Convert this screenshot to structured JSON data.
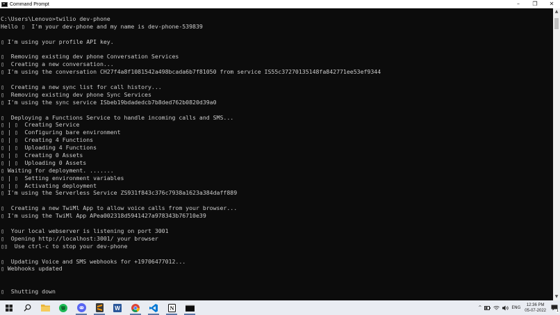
{
  "window": {
    "title": "Command Prompt",
    "controls": {
      "minimize": "–",
      "maximize": "❐",
      "close": "✕"
    }
  },
  "console": {
    "lines": [
      "C:\\Users\\Lenovo>twilio dev-phone",
      "Hello ▯  I'm your dev-phone and my name is dev-phone-539839",
      "",
      "▯ I'm using your profile API key.",
      "",
      "▯  Removing existing dev phone Conversation Services",
      "▯  Creating a new conversation...",
      "▯ I'm using the conversation CH27f4a8f1081542a498bcada6b7f81050 from service IS55c37270135148fa842771ee53ef9344",
      "",
      "▯  Creating a new sync list for call history...",
      "▯  Removing existing dev phone Sync Services",
      "▯ I'm using the sync service ISbeb19bdadedcb7b8ded762b0820d39a0",
      "",
      "▯  Deploying a Functions Service to handle incoming calls and SMS...",
      "▯ | ▯  Creating Service",
      "▯ | ▯  Configuring bare environment",
      "▯ | ▯  Creating 4 Functions",
      "▯ | ▯  Uploading 4 Functions",
      "▯ | ▯  Creating 0 Assets",
      "▯ | ▯  Uploading 0 Assets",
      "▯ Waiting for deployment. .......",
      "▯ | ▯  Setting environment variables",
      "▯ | ▯  Activating deployment",
      "▯ I'm using the Serverless Service ZS931f843c376c7938a1623a384daff889",
      "",
      "▯  Creating a new TwiMl App to allow voice calls from your browser...",
      "▯ I'm using the TwiMl App APea002318d5941427a978343b76710e39",
      "",
      "▯  Your local webserver is listening on port 3001",
      "▯  Opening http://localhost:3001/ your browser",
      "▯▯  Use ctrl-c to stop your dev-phone",
      "",
      "▯  Updating Voice and SMS webhooks for +19706477012...",
      "▯ Webhooks updated",
      "",
      "",
      "▯  Shutting down"
    ]
  },
  "scrollbar": {
    "up": "▲",
    "down": "▼"
  },
  "taskbar": {
    "icons": [
      {
        "name": "windows-start-icon",
        "color": "#1f1f1f"
      },
      {
        "name": "search-icon",
        "color": "#1f1f1f"
      },
      {
        "name": "file-explorer-icon",
        "color": "#e8b43a"
      },
      {
        "name": "spotify-icon",
        "color": "#1db954"
      },
      {
        "name": "discord-icon",
        "color": "#5865f2"
      },
      {
        "name": "sublime-text-icon",
        "color": "#3b3b3b"
      },
      {
        "name": "word-icon",
        "color": "#2b579a"
      },
      {
        "name": "chrome-icon",
        "color": "#db4437"
      },
      {
        "name": "vscode-icon",
        "color": "#0078d4"
      },
      {
        "name": "notion-icon",
        "color": "#111111"
      },
      {
        "name": "command-prompt-icon",
        "color": "#0c0c0c"
      }
    ],
    "tray": {
      "chevron": "^",
      "language": "ENG",
      "time": "12:36 PM",
      "date": "05-07-2022",
      "notification_count": "1"
    }
  },
  "colors": {
    "console_bg": "#0c0c0c",
    "console_text": "#cccccc",
    "taskbar_bg": "#e9ecf2"
  }
}
